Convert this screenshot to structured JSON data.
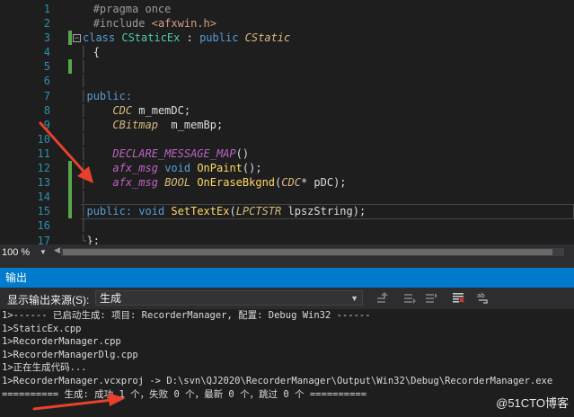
{
  "editor": {
    "line_numbers": [
      "1",
      "2",
      "3",
      "4",
      "5",
      "6",
      "7",
      "8",
      "9",
      "10",
      "11",
      "12",
      "13",
      "14",
      "15",
      "16",
      "17"
    ],
    "lines": {
      "l1": "#pragma once",
      "l2_pre": "#include ",
      "l2_str": "<afxwin.h>",
      "l3_kw": "class",
      "l3_name": "CStaticEx",
      "l3_sep": " : ",
      "l3_pub": "public",
      "l3_base": "CStatic",
      "l4": "{",
      "l6": "public:",
      "l7_type": "CDC",
      "l7_var": " m_memDC;",
      "l8_type": "CBitmap",
      "l8_var": "  m_memBp;",
      "l10_macro": "DECLARE_MESSAGE_MAP",
      "l10_rest": "()",
      "l11_afx": "afx_msg",
      "l11_void": "void",
      "l11_fn": "OnPaint",
      "l11_rest": "();",
      "l12_afx": "afx_msg",
      "l12_type": "BOOL",
      "l12_fn": "OnEraseBkgnd",
      "l12_param_type": "CDC",
      "l12_rest": "* pDC);",
      "l14_pub": "public:",
      "l14_void": "void",
      "l14_fn": "SetTextEx",
      "l14_param_type": "LPCTSTR",
      "l14_rest": " lpszString);",
      "l16": "};"
    }
  },
  "zoom": {
    "value": "100 %"
  },
  "output": {
    "title": "输出",
    "source_label": "显示输出来源(S):",
    "source_value": "生成",
    "lines": [
      "1>------ 已启动生成: 项目: RecorderManager, 配置: Debug Win32 ------",
      "1>StaticEx.cpp",
      "1>RecorderManager.cpp",
      "1>RecorderManagerDlg.cpp",
      "1>正在生成代码...",
      "1>RecorderManager.vcxproj -> D:\\svn\\QJ2020\\RecorderManager\\Output\\Win32\\Debug\\RecorderManager.exe",
      "========== 生成: 成功 1 个，失败 0 个，最新 0 个，跳过 0 个 =========="
    ]
  },
  "watermark": "@51CTO博客",
  "colors": {
    "accent": "#007acc",
    "changebar": "#57a64a",
    "arrow": "#e8402d"
  }
}
